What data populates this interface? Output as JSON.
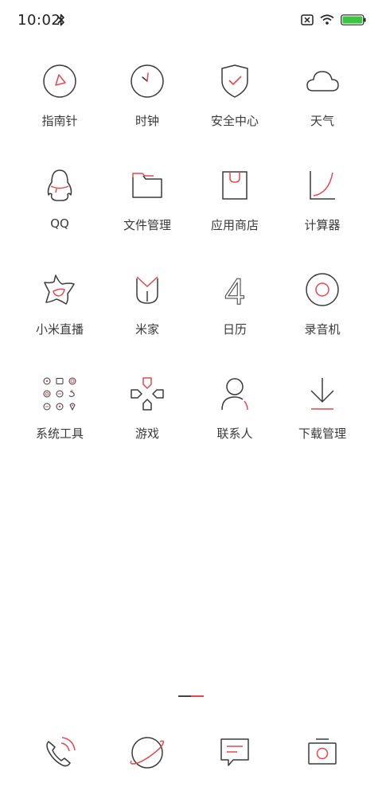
{
  "status": {
    "time": "10:02",
    "bluetooth_icon": "bluetooth-icon",
    "sim_icon": "no-sim-icon",
    "wifi_icon": "wifi-icon",
    "battery_icon": "battery-icon",
    "battery_color": "#3cc443"
  },
  "apps": [
    {
      "label": "指南针",
      "icon": "compass-icon"
    },
    {
      "label": "时钟",
      "icon": "clock-icon"
    },
    {
      "label": "安全中心",
      "icon": "shield-icon"
    },
    {
      "label": "天气",
      "icon": "cloud-icon"
    },
    {
      "label": "QQ",
      "icon": "penguin-icon"
    },
    {
      "label": "文件管理",
      "icon": "folder-icon"
    },
    {
      "label": "应用商店",
      "icon": "shopping-bag-icon"
    },
    {
      "label": "计算器",
      "icon": "graph-icon"
    },
    {
      "label": "小米直播",
      "icon": "star-icon"
    },
    {
      "label": "米家",
      "icon": "mijia-icon"
    },
    {
      "label": "日历",
      "icon": "calendar-four-icon"
    },
    {
      "label": "录音机",
      "icon": "record-icon"
    },
    {
      "label": "系统工具",
      "icon": "tools-grid-icon"
    },
    {
      "label": "游戏",
      "icon": "gamepad-icon"
    },
    {
      "label": "联系人",
      "icon": "person-icon"
    },
    {
      "label": "下载管理",
      "icon": "download-icon"
    }
  ],
  "calendar_day": "4",
  "dock": [
    {
      "icon": "phone-icon"
    },
    {
      "icon": "browser-planet-icon"
    },
    {
      "icon": "message-icon"
    },
    {
      "icon": "camera-icon"
    }
  ],
  "colors": {
    "accent": "#e8474b",
    "stroke": "#3a3a3a"
  }
}
